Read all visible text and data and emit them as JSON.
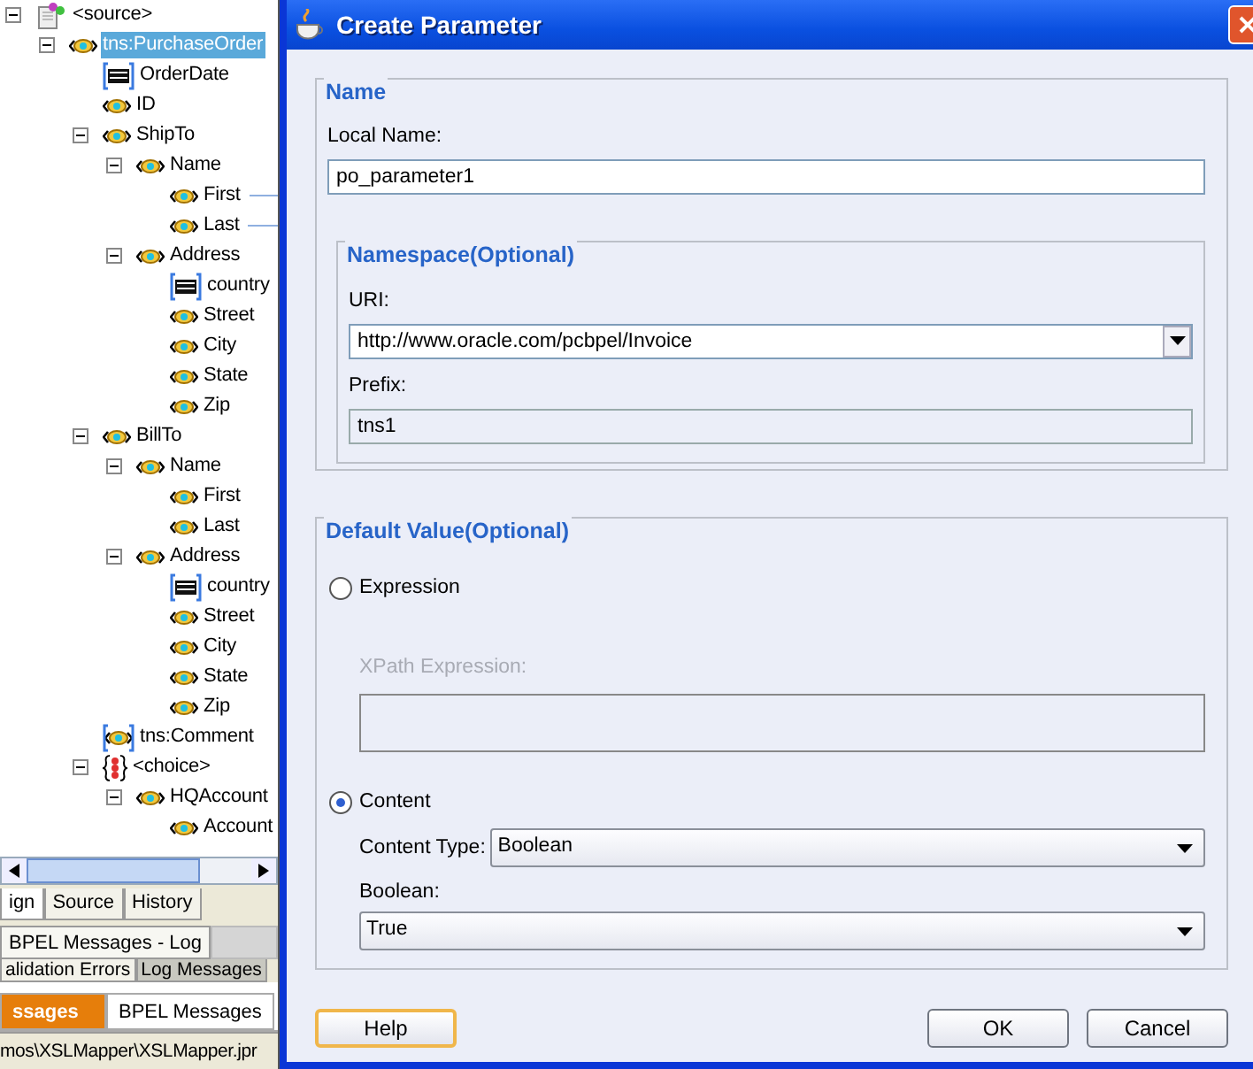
{
  "tree": [
    {
      "label": "<source>",
      "kind": "root",
      "expanded": true,
      "selected": false,
      "children": [
        {
          "label": "tns:PurchaseOrder",
          "kind": "element",
          "expanded": true,
          "selected": true,
          "children": [
            {
              "label": "OrderDate",
              "kind": "attribute",
              "expanded": false,
              "selected": false
            },
            {
              "label": "ID",
              "kind": "element",
              "expanded": false,
              "selected": false
            },
            {
              "label": "ShipTo",
              "kind": "element",
              "expanded": true,
              "selected": false,
              "children": [
                {
                  "label": "Name",
                  "kind": "element",
                  "expanded": true,
                  "selected": false,
                  "children": [
                    {
                      "label": "First",
                      "kind": "element",
                      "expanded": false,
                      "selected": false,
                      "mapped": true
                    },
                    {
                      "label": "Last",
                      "kind": "element",
                      "expanded": false,
                      "selected": false,
                      "mapped": true
                    }
                  ]
                },
                {
                  "label": "Address",
                  "kind": "element",
                  "expanded": true,
                  "selected": false,
                  "children": [
                    {
                      "label": "country",
                      "kind": "attribute",
                      "expanded": false,
                      "selected": false
                    },
                    {
                      "label": "Street",
                      "kind": "element",
                      "expanded": false,
                      "selected": false
                    },
                    {
                      "label": "City",
                      "kind": "element",
                      "expanded": false,
                      "selected": false
                    },
                    {
                      "label": "State",
                      "kind": "element",
                      "expanded": false,
                      "selected": false
                    },
                    {
                      "label": "Zip",
                      "kind": "element",
                      "expanded": false,
                      "selected": false
                    }
                  ]
                }
              ]
            },
            {
              "label": "BillTo",
              "kind": "element",
              "expanded": true,
              "selected": false,
              "children": [
                {
                  "label": "Name",
                  "kind": "element",
                  "expanded": true,
                  "selected": false,
                  "children": [
                    {
                      "label": "First",
                      "kind": "element",
                      "expanded": false,
                      "selected": false
                    },
                    {
                      "label": "Last",
                      "kind": "element",
                      "expanded": false,
                      "selected": false
                    }
                  ]
                },
                {
                  "label": "Address",
                  "kind": "element",
                  "expanded": true,
                  "selected": false,
                  "children": [
                    {
                      "label": "country",
                      "kind": "attribute",
                      "expanded": false,
                      "selected": false
                    },
                    {
                      "label": "Street",
                      "kind": "element",
                      "expanded": false,
                      "selected": false
                    },
                    {
                      "label": "City",
                      "kind": "element",
                      "expanded": false,
                      "selected": false
                    },
                    {
                      "label": "State",
                      "kind": "element",
                      "expanded": false,
                      "selected": false
                    },
                    {
                      "label": "Zip",
                      "kind": "element",
                      "expanded": false,
                      "selected": false
                    }
                  ]
                }
              ]
            },
            {
              "label": "tns:Comment",
              "kind": "optional",
              "expanded": false,
              "selected": false
            },
            {
              "label": "<choice>",
              "kind": "choice",
              "expanded": true,
              "selected": false,
              "children": [
                {
                  "label": "HQAccount",
                  "kind": "element",
                  "expanded": true,
                  "selected": false,
                  "children": [
                    {
                      "label": "Account",
                      "kind": "element",
                      "expanded": false,
                      "selected": false
                    }
                  ]
                }
              ]
            }
          ]
        }
      ]
    }
  ],
  "editor_tabs": [
    {
      "label": "ign",
      "selected": true
    },
    {
      "label": "Source",
      "selected": false
    },
    {
      "label": "History",
      "selected": false
    }
  ],
  "log_title": "BPEL Messages - Log",
  "log_tabs": [
    {
      "label": "alidation Errors",
      "selected": true
    },
    {
      "label": "Log Messages",
      "selected": false
    }
  ],
  "message_tabs": [
    {
      "label": "ssages",
      "selected": true
    },
    {
      "label": "BPEL Messages",
      "selected": false
    }
  ],
  "status_bar": "mos\\XSLMapper\\XSLMapper.jpr",
  "dialog": {
    "title": "Create Parameter",
    "name_group": {
      "legend": "Name",
      "local_name": {
        "label": "Local Name:",
        "value": "po_parameter1"
      },
      "namespace": {
        "legend": "Namespace(Optional)",
        "uri": {
          "label": "URI:",
          "value": "http://www.oracle.com/pcbpel/Invoice"
        },
        "prefix": {
          "label": "Prefix:",
          "value": "tns1",
          "disabled": true
        }
      }
    },
    "default_group": {
      "legend": "Default Value(Optional)",
      "options": [
        {
          "label": "Expression",
          "selected": false
        },
        {
          "label": "Content",
          "selected": true
        }
      ],
      "xpath": {
        "label": "XPath Expression:",
        "disabled": true
      },
      "content_type": {
        "label": "Content Type:",
        "value": "Boolean"
      },
      "boolean": {
        "label": "Boolean:",
        "value": "True"
      }
    },
    "buttons": [
      {
        "label": "Help",
        "focused": true
      },
      {
        "label": "OK",
        "focused": false
      },
      {
        "label": "Cancel",
        "focused": false
      }
    ]
  }
}
